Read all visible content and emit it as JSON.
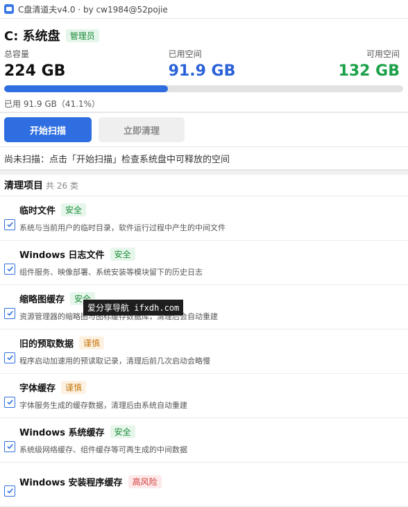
{
  "window": {
    "title": "C盘清道夫v4.0 · by cw1984@52pojie"
  },
  "disk": {
    "title": "C: 系统盘",
    "admin_badge": "管理员",
    "total_label": "总容量",
    "total_value": "224 GB",
    "used_label": "已用空间",
    "used_value": "91.9 GB",
    "free_label": "可用空间",
    "free_value": "132 GB",
    "usage_text": "已用 91.9 GB（41.1%）",
    "used_fraction": 0.411
  },
  "actions": {
    "scan_label": "开始扫描",
    "clean_label": "立即清理"
  },
  "status": {
    "text": "尚未扫描：点击「开始扫描」检查系统盘中可释放的空间"
  },
  "list": {
    "title": "清理项目",
    "count": "共 26 类",
    "items": [
      {
        "name": "临时文件",
        "badge": "安全",
        "level": "safe",
        "desc": "系统与当前用户的临时目录，软件运行过程中产生的中间文件"
      },
      {
        "name": "Windows 日志文件",
        "badge": "安全",
        "level": "safe",
        "desc": "组件服务、映像部署、系统安装等模块留下的历史日志"
      },
      {
        "name": "缩略图缓存",
        "badge": "安全",
        "level": "safe",
        "desc": "资源管理器的缩略图与图标缓存数据库，清理后会自动重建"
      },
      {
        "name": "旧的预取数据",
        "badge": "谨慎",
        "level": "caution",
        "desc": "程序启动加速用的预读取记录，清理后前几次启动会略慢"
      },
      {
        "name": "字体缓存",
        "badge": "谨慎",
        "level": "caution",
        "desc": "字体服务生成的缓存数据，清理后由系统自动重建"
      },
      {
        "name": "Windows 系统缓存",
        "badge": "安全",
        "level": "safe",
        "desc": "系统级网络缓存、组件缓存等可再生成的中间数据"
      },
      {
        "name": "Windows 安装程序缓存",
        "badge": "高风险",
        "level": "risk",
        "desc": ""
      }
    ]
  },
  "tooltip": {
    "text": "爱分享导航 ifxdh.com"
  }
}
